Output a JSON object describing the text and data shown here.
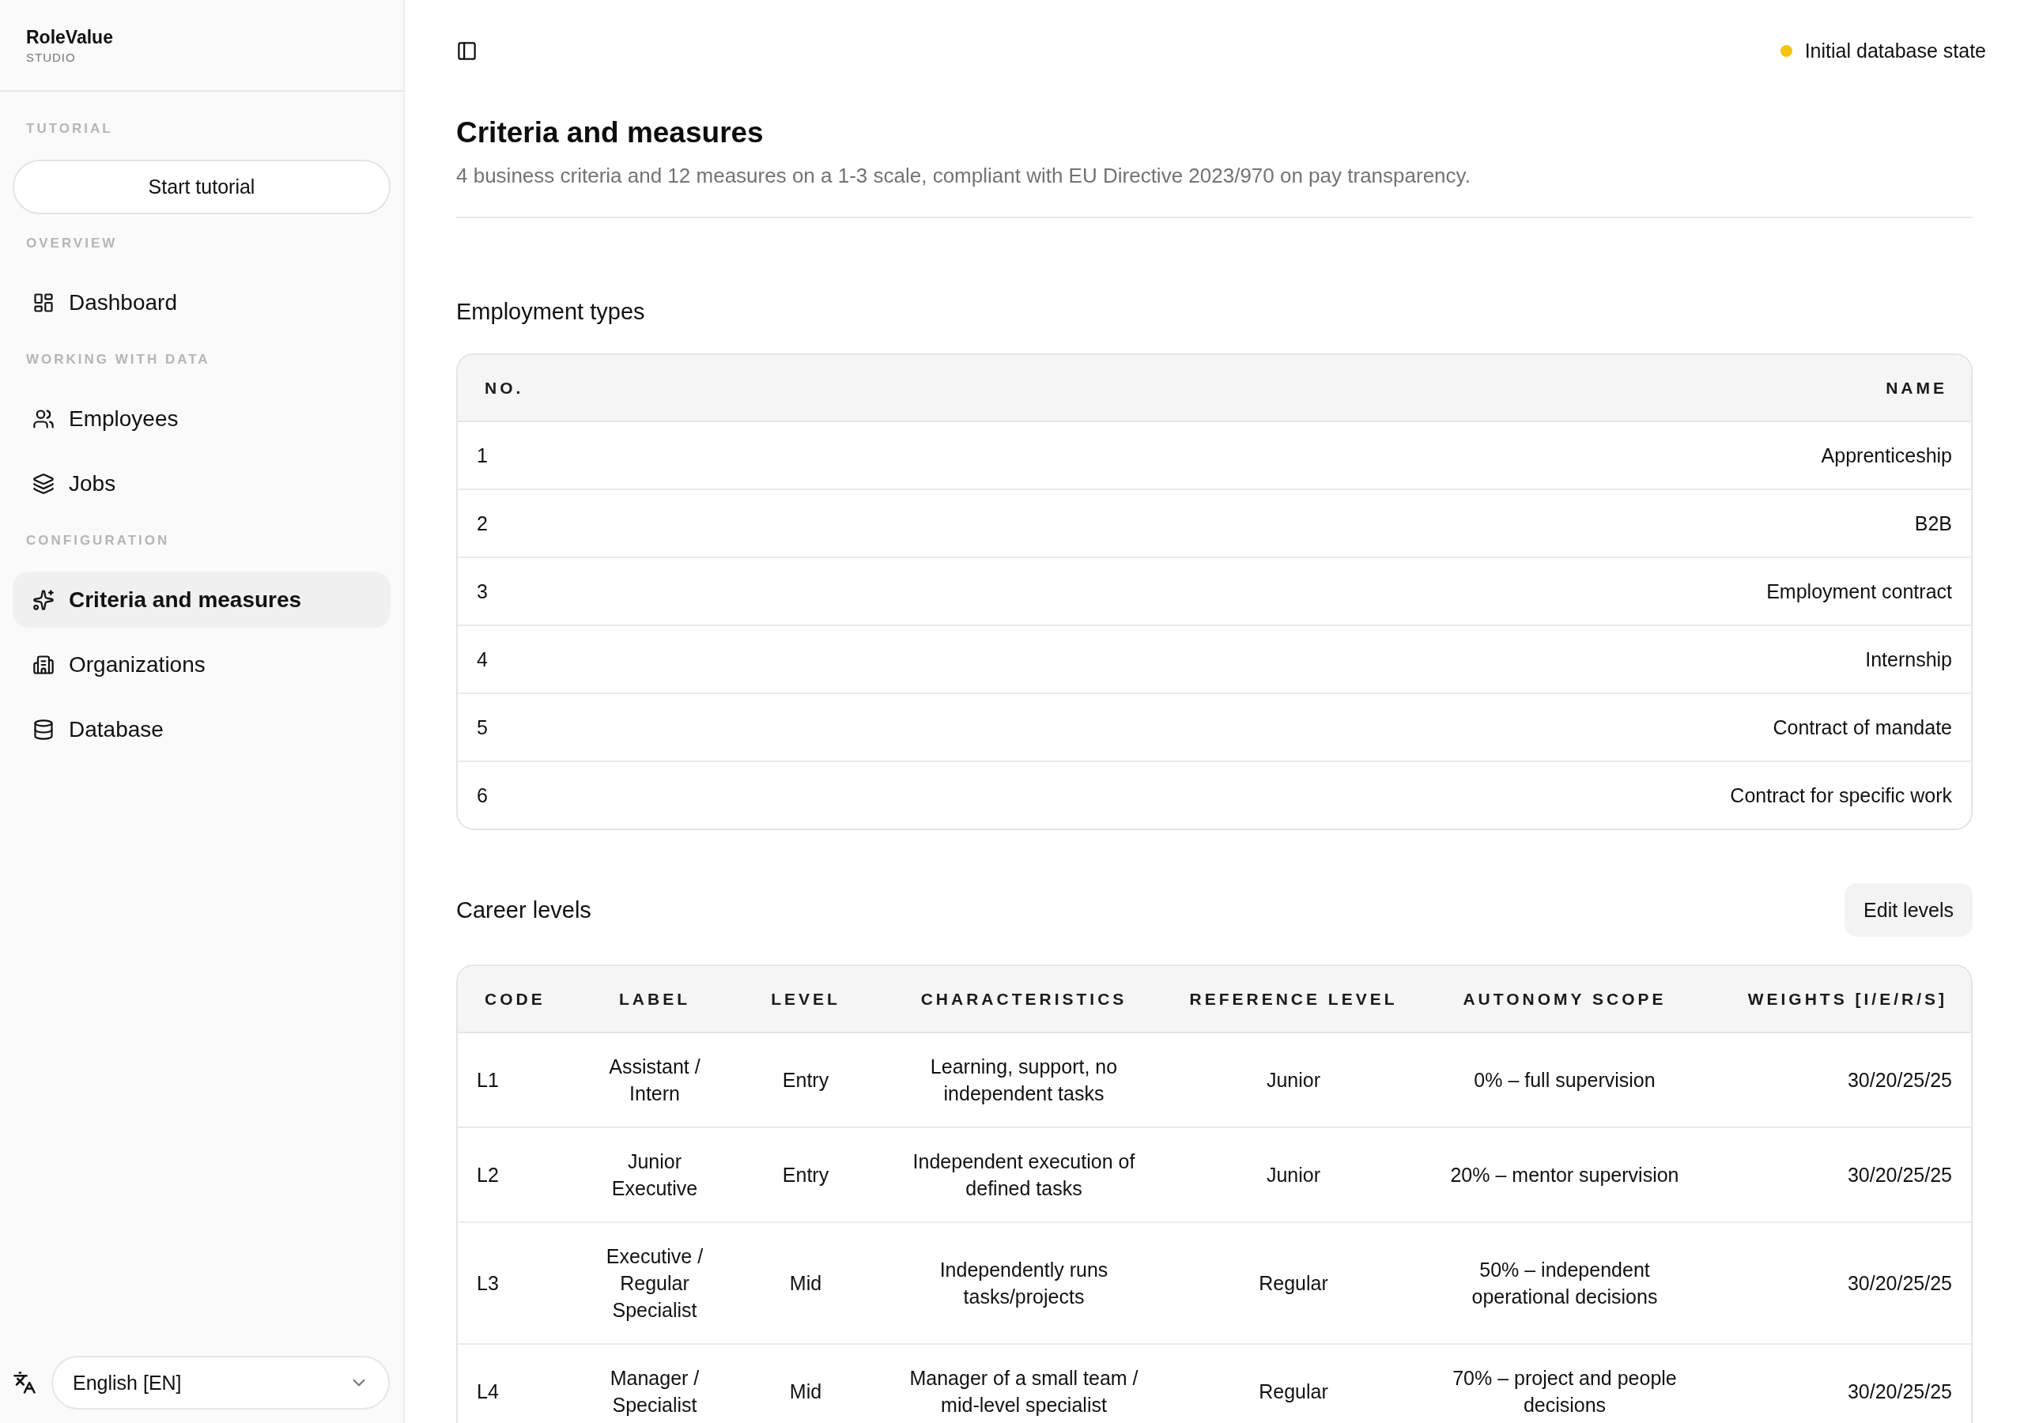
{
  "sidebar": {
    "brand": {
      "name": "RoleValue",
      "tagline": "STUDIO"
    },
    "sections": [
      {
        "title": "TUTORIAL",
        "kind": "button",
        "button": "Start tutorial"
      },
      {
        "title": "OVERVIEW",
        "kind": "nav",
        "items": [
          {
            "label": "Dashboard",
            "selected": false
          }
        ]
      },
      {
        "title": "WORKING WITH DATA",
        "kind": "nav",
        "items": [
          {
            "label": "Employees",
            "selected": false
          },
          {
            "label": "Jobs",
            "selected": false
          }
        ]
      },
      {
        "title": "CONFIGURATION",
        "kind": "nav",
        "items": [
          {
            "label": "Criteria and measures",
            "selected": true
          },
          {
            "label": "Organizations",
            "selected": false
          },
          {
            "label": "Database",
            "selected": false
          }
        ]
      }
    ],
    "language_select": {
      "value": "English [EN]"
    }
  },
  "header": {
    "status": {
      "label": "Initial database state",
      "color": "#f6c30f"
    }
  },
  "page": {
    "title": "Criteria and measures",
    "subtitle": "4 business criteria and 12 measures on a 1-3 scale, compliant with EU Directive 2023/970 on pay transparency."
  },
  "employment_types": {
    "title": "Employment types",
    "columns": [
      "NO.",
      "NAME"
    ],
    "rows": [
      [
        "1",
        "Apprenticeship"
      ],
      [
        "2",
        "B2B"
      ],
      [
        "3",
        "Employment contract"
      ],
      [
        "4",
        "Internship"
      ],
      [
        "5",
        "Contract of mandate"
      ],
      [
        "6",
        "Contract for specific work"
      ]
    ]
  },
  "career_levels": {
    "title": "Career levels",
    "button": "Edit levels",
    "columns": [
      "CODE",
      "LABEL",
      "LEVEL",
      "CHARACTERISTICS",
      "REFERENCE LEVEL",
      "AUTONOMY SCOPE",
      "WEIGHTS [I/E/R/S]"
    ],
    "rows": [
      [
        "L1",
        "Assistant / Intern",
        "Entry",
        "Learning, support, no independent tasks",
        "Junior",
        "0% – full supervision",
        "30/20/25/25"
      ],
      [
        "L2",
        "Junior Executive",
        "Entry",
        "Independent execution of defined tasks",
        "Junior",
        "20% – mentor supervision",
        "30/20/25/25"
      ],
      [
        "L3",
        "Executive / Regular Specialist",
        "Mid",
        "Independently runs tasks/projects",
        "Regular",
        "50% – independent operational decisions",
        "30/20/25/25"
      ],
      [
        "L4",
        "Manager / Specialist",
        "Mid",
        "Manager of a small team / mid-level specialist",
        "Regular",
        "70% – project and people decisions",
        "30/20/25/25"
      ]
    ]
  }
}
